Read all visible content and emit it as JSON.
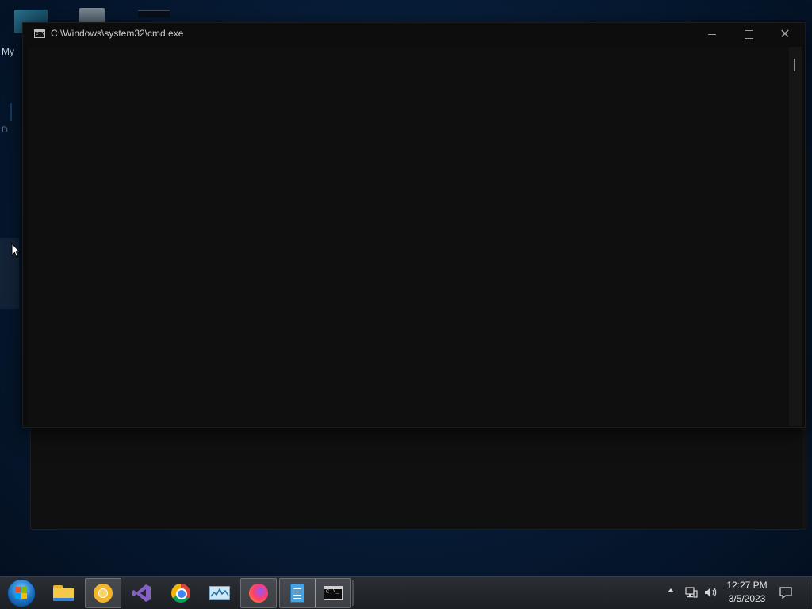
{
  "desktop": {
    "icon_label_1": "My",
    "icon_label_2": "D"
  },
  "window": {
    "title": "C:\\Windows\\system32\\cmd.exe",
    "console_lines": []
  },
  "taskbar": {
    "items": [
      {
        "name": "start-button",
        "icon": "windows-logo-icon"
      },
      {
        "name": "file-explorer",
        "icon": "folder-icon"
      },
      {
        "name": "chromium",
        "icon": "chromium-icon"
      },
      {
        "name": "visual-studio",
        "icon": "visual-studio-icon"
      },
      {
        "name": "google-chrome",
        "icon": "chrome-icon"
      },
      {
        "name": "resource-monitor",
        "icon": "monitor-icon"
      },
      {
        "name": "firefox",
        "icon": "firefox-icon"
      },
      {
        "name": "notepad",
        "icon": "notepad-icon"
      },
      {
        "name": "command-prompt",
        "icon": "cmd-icon"
      }
    ],
    "clock": {
      "time": "12:27 PM",
      "date": "3/5/2023"
    }
  },
  "colors": {
    "console_bg": "#0c0c0c",
    "taskbar_bg": "#1f2227",
    "desktop_bg": "#061a33"
  }
}
